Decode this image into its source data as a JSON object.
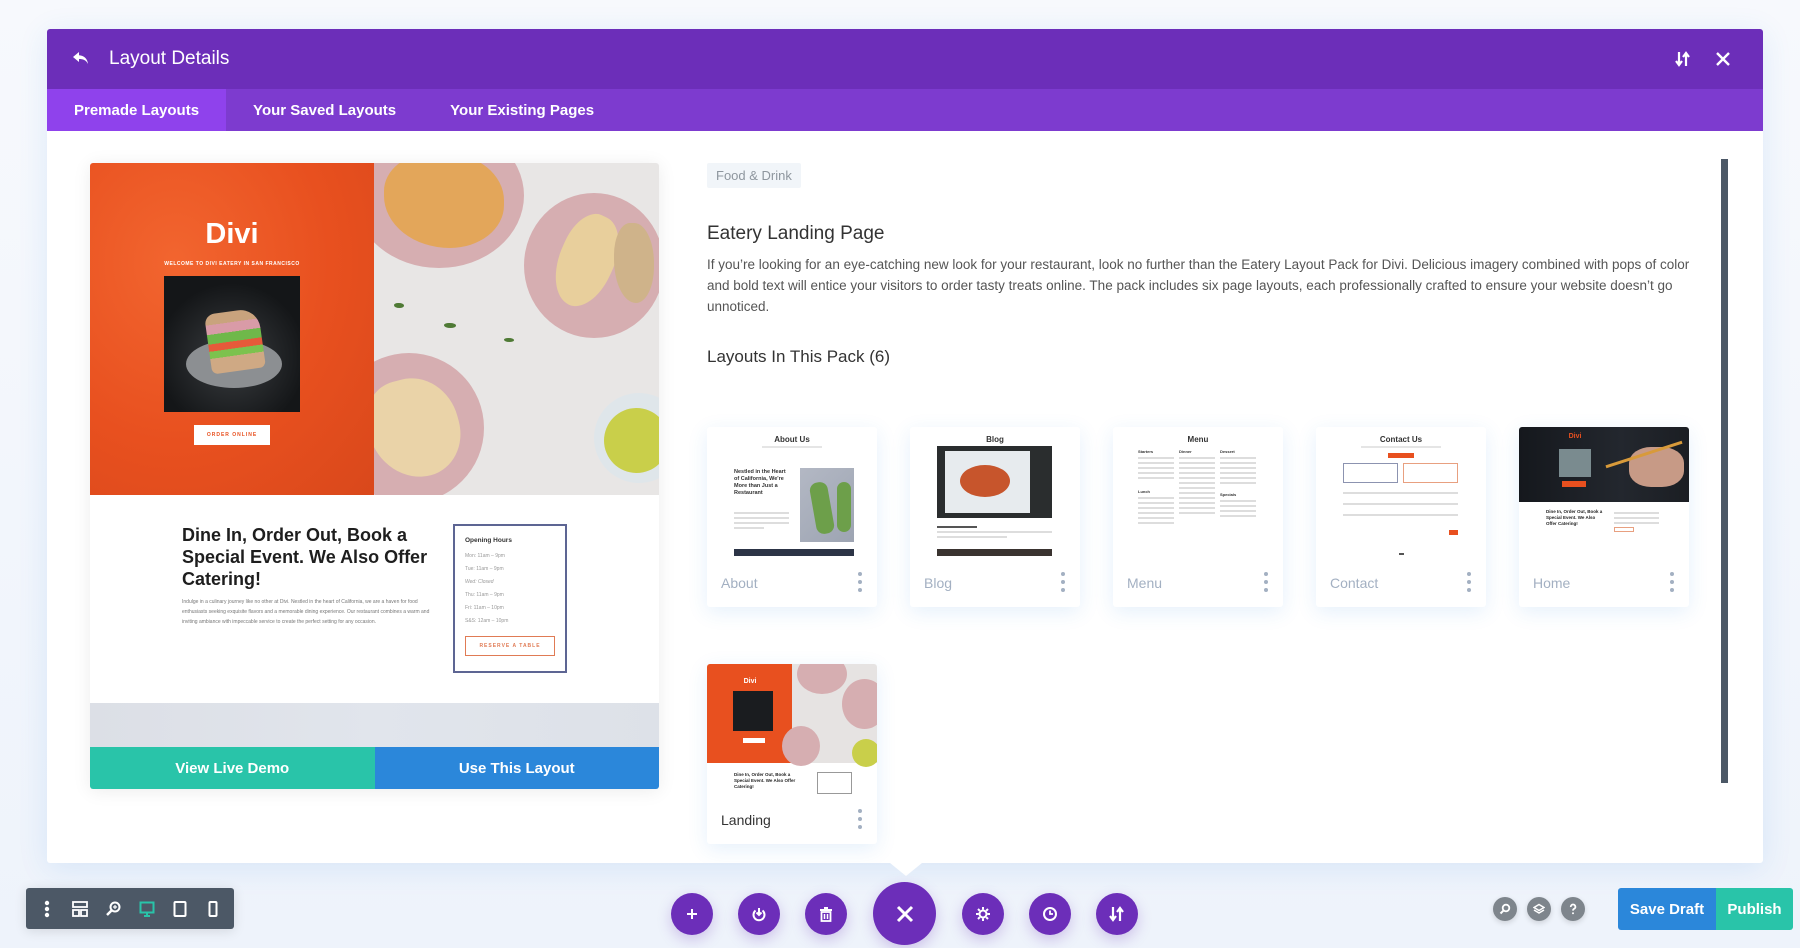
{
  "modal": {
    "title": "Layout Details",
    "back_icon": "undo-arrow-icon",
    "sort_icon": "sort-arrows-icon",
    "close_icon": "close-x-icon"
  },
  "tabs": [
    {
      "label": "Premade Layouts",
      "active": true
    },
    {
      "label": "Your Saved Layouts",
      "active": false
    },
    {
      "label": "Your Existing Pages",
      "active": false
    }
  ],
  "preview": {
    "hero_brand": "Divi",
    "hero_tagline": "WELCOME TO DIVI EATERY IN SAN FRANCISCO",
    "hero_button": "ORDER ONLINE",
    "info_heading": "Dine In, Order Out, Book a Special Event. We Also Offer Catering!",
    "info_paragraph": "Indulge in a culinary journey like no other at Divi. Nestled in the heart of California, we are a haven for food enthusiasts seeking exquisite flavors and a memorable dining experience. Our restaurant combines a warm and inviting ambiance with impeccable service to create the perfect setting for any occasion.",
    "hours_title": "Opening Hours",
    "hours": [
      "Mon: 11am – 9pm",
      "Tue: 11am – 9pm",
      "Wed: Closed",
      "Thu: 11am – 9pm",
      "Fri: 11am – 10pm",
      "S&S: 12am – 10pm"
    ],
    "hours_button": "RESERVE A TABLE",
    "view_demo_label": "View Live Demo",
    "use_layout_label": "Use This Layout"
  },
  "details": {
    "category": "Food & Drink",
    "title": "Eatery Landing Page",
    "description": "If you’re looking for an eye-catching new look for your restaurant, look no further than the Eatery Layout Pack for Divi. Delicious imagery combined with pops of color and bold text will entice your visitors to order tasty treats online. The pack includes six page layouts, each professionally crafted to ensure your website doesn’t go unnoticed.",
    "layouts_heading": "Layouts In This Pack (6)"
  },
  "layouts": [
    {
      "label": "About",
      "thumb_title": "About Us",
      "thumb_heading": "Nestled in the Heart of California, We're More than Just a Restaurant"
    },
    {
      "label": "Blog",
      "thumb_title": "Blog"
    },
    {
      "label": "Menu",
      "thumb_title": "Menu",
      "thumb_cols": [
        "Starters",
        "Dinner",
        "Dessert",
        "Lunch",
        "Specials"
      ]
    },
    {
      "label": "Contact",
      "thumb_title": "Contact Us"
    },
    {
      "label": "Home",
      "thumb_title": "Divi",
      "thumb_heading": "Dine In, Order Out, Book a Special Event. We Also Offer Catering!"
    },
    {
      "label": "Landing",
      "thumb_title": "Divi",
      "thumb_heading": "Dine In, Order Out, Book a Special Event. We Also Offer Catering!"
    }
  ],
  "left_toolbar": [
    {
      "name": "menu-dots-icon"
    },
    {
      "name": "wireframe-icon"
    },
    {
      "name": "zoom-icon"
    },
    {
      "name": "desktop-view-icon",
      "active": true
    },
    {
      "name": "tablet-view-icon"
    },
    {
      "name": "phone-view-icon"
    }
  ],
  "center_toolbar": [
    {
      "name": "add-icon"
    },
    {
      "name": "power-icon"
    },
    {
      "name": "trash-icon"
    },
    {
      "name": "close-x-icon"
    },
    {
      "name": "settings-gear-icon"
    },
    {
      "name": "history-clock-icon"
    },
    {
      "name": "portability-arrows-icon"
    }
  ],
  "right_bar": {
    "icons": [
      "search-icon",
      "layers-icon",
      "help-icon"
    ],
    "save_draft_label": "Save Draft",
    "publish_label": "Publish"
  },
  "colors": {
    "header": "#6c2eb9",
    "tabbar": "#7d3bcf",
    "tab_active": "#8f42ec",
    "demo_button": "#29c4a9",
    "use_button": "#2b87da",
    "hero_orange": "#e8501f"
  }
}
